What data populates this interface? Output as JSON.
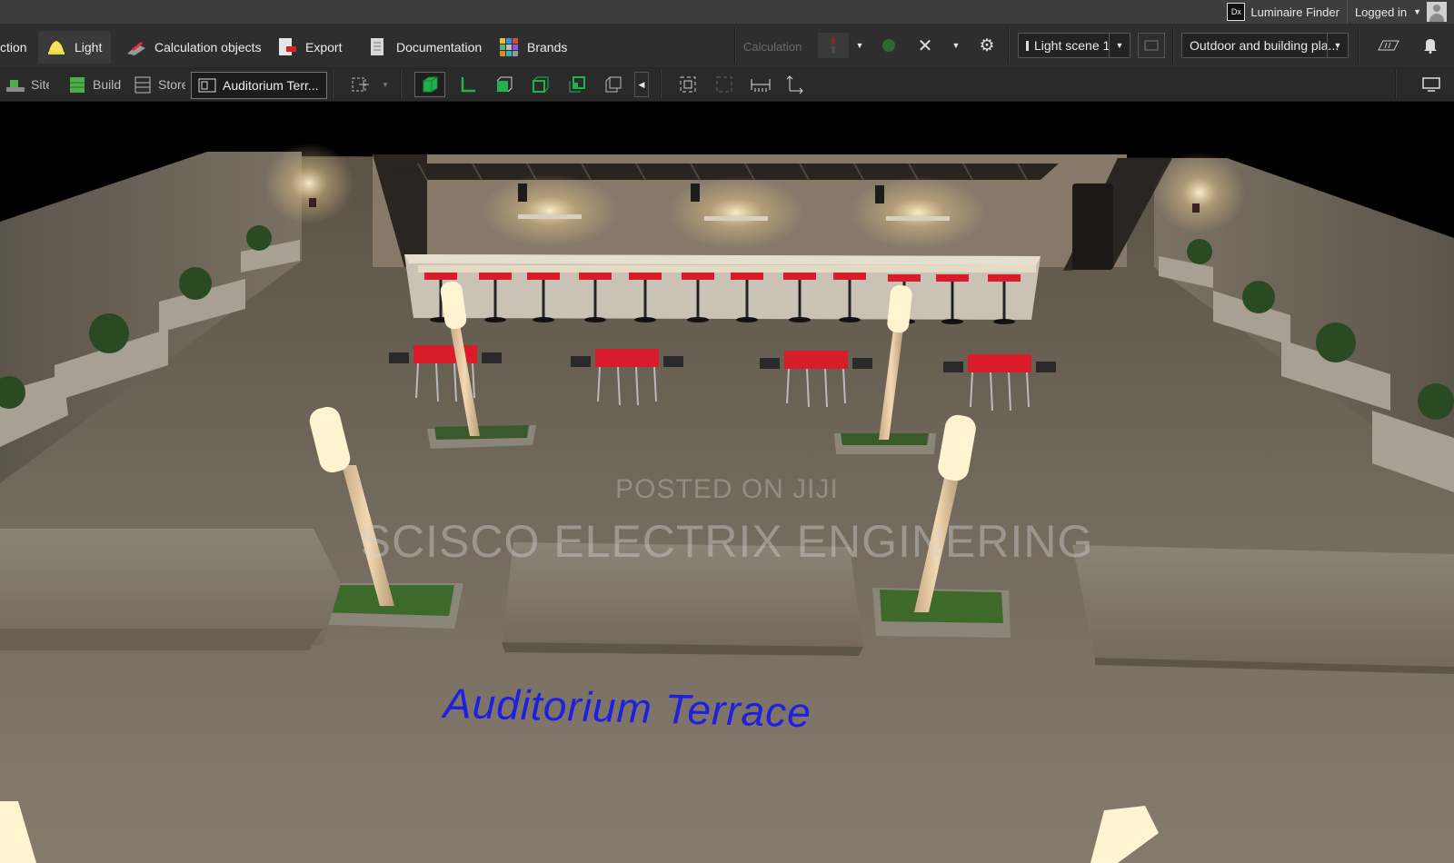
{
  "topbar": {
    "logo_text": "Dx",
    "luminaire_finder": "Luminaire Finder",
    "login": "Logged in"
  },
  "menu": {
    "items": [
      {
        "label": "ction",
        "icon": "construction-icon"
      },
      {
        "label": "Light",
        "icon": "lamp-icon",
        "active": true
      },
      {
        "label": "Calculation objects",
        "icon": "calculation-objects-icon"
      },
      {
        "label": "Export",
        "icon": "export-icon"
      },
      {
        "label": "Documentation",
        "icon": "documentation-icon"
      },
      {
        "label": "Brands",
        "icon": "brands-icon"
      }
    ],
    "calculation_label": "Calculation",
    "light_scene": "Light scene 1",
    "plan_view": "Outdoor and building pla..."
  },
  "toolbar": {
    "site": "Site",
    "building": "Buildi",
    "storey": "Store",
    "room": "Auditorium Terr..."
  },
  "viewport": {
    "watermark_small": "POSTED ON JIJI",
    "watermark_large": "SCISCO ELECTRIX ENGINERING",
    "room_label": "Auditorium Terrace"
  },
  "colors": {
    "accent_green": "#22b14c",
    "chair_red": "#d81c2a",
    "label_blue": "#1f1fe0"
  }
}
